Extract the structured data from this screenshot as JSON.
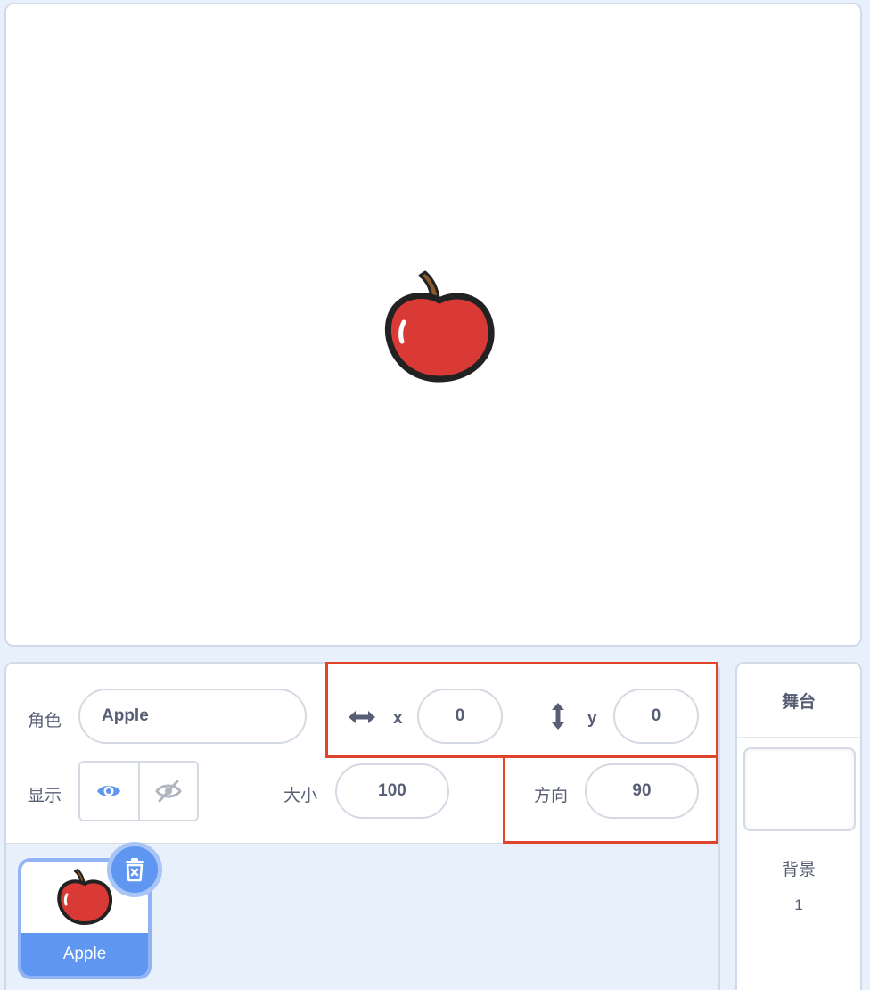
{
  "stage": {
    "sprite_icon": "apple-icon"
  },
  "sprite_info": {
    "sprite_label": "角色",
    "sprite_name": "Apple",
    "x_icon": "horizontal-arrows-icon",
    "x_label": "x",
    "x_value": "0",
    "y_icon": "vertical-arrows-icon",
    "y_label": "y",
    "y_value": "0",
    "show_label": "显示",
    "show_visible_icon": "eye-icon",
    "show_hidden_icon": "eye-slash-icon",
    "size_label": "大小",
    "size_value": "100",
    "direction_label": "方向",
    "direction_value": "90"
  },
  "sprite_list": {
    "items": [
      {
        "name": "Apple",
        "icon": "apple-icon",
        "selected": true
      }
    ],
    "delete_icon": "trash-icon"
  },
  "stage_panel": {
    "title": "舞台",
    "backdrops_label": "背景",
    "backdrops_count": "1"
  },
  "colors": {
    "accent": "#5e96f1",
    "highlight": "#e0442a",
    "text": "#575e75",
    "background": "#e8f0fb"
  }
}
